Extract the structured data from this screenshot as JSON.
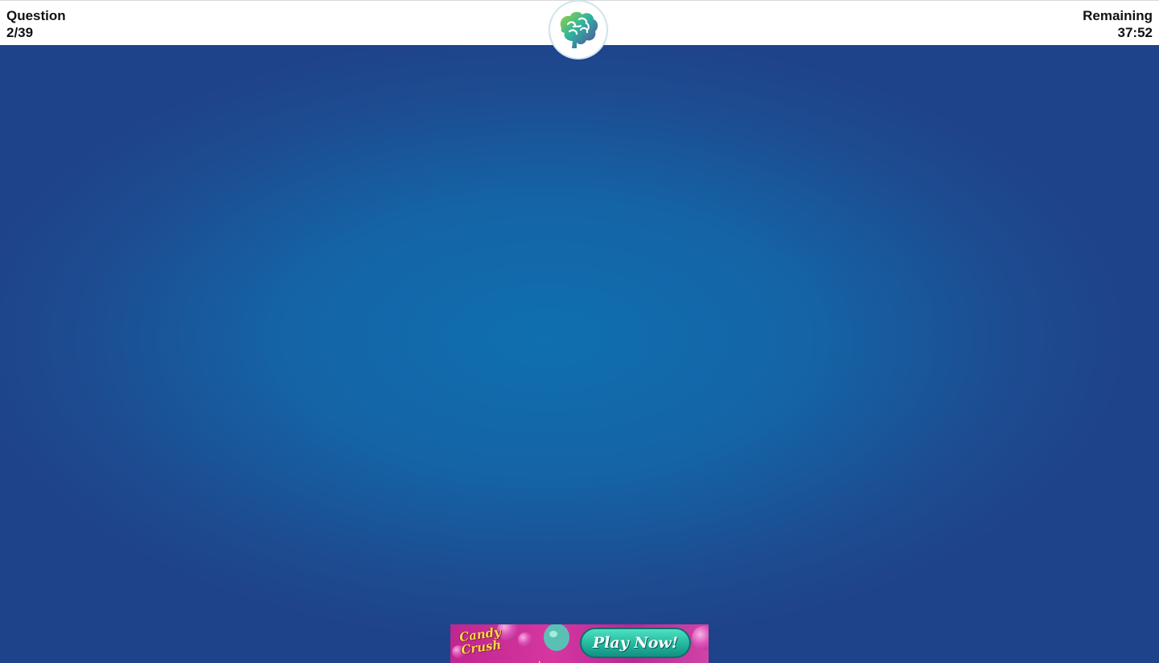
{
  "header": {
    "question_label": "Question",
    "question_progress": "2/39",
    "timer_label": "Remaining",
    "timer_value": "37:52"
  },
  "logo": {
    "icon": "brain-icon"
  },
  "ad": {
    "brand": "Candy Crush",
    "cta_label": "Play Now!"
  },
  "colors": {
    "background": "#1a5fa3",
    "topbar": "#ffffff",
    "ad_background": "#c0268f",
    "ad_button": "#1fb39a"
  }
}
